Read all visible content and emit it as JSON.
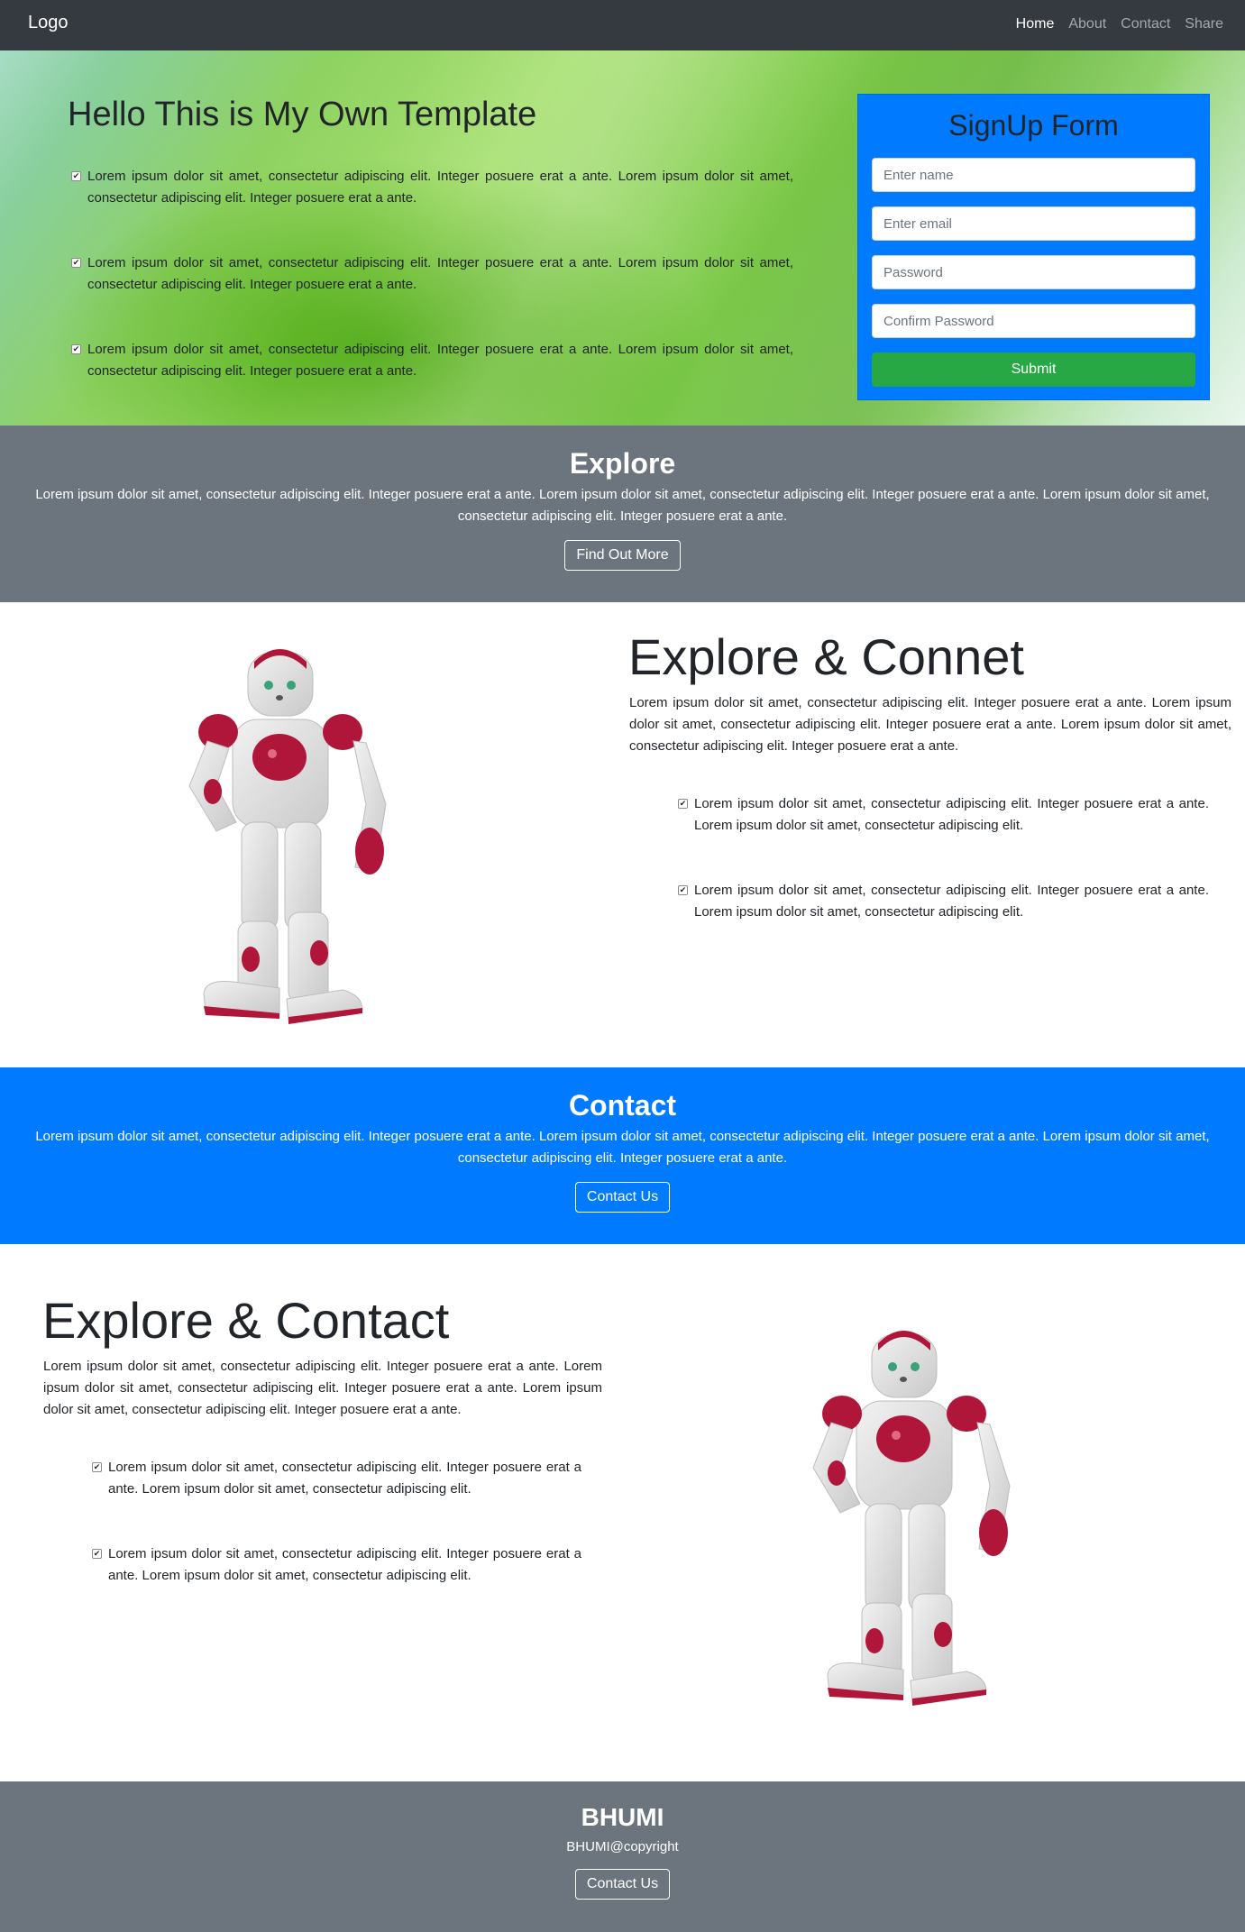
{
  "nav": {
    "brand": "Logo",
    "links": [
      "Home",
      "About",
      "Contact",
      "Share"
    ]
  },
  "hero": {
    "title": "Hello This is My Own Template",
    "items": [
      "Lorem ipsum dolor sit amet, consectetur adipiscing elit. Integer posuere erat a ante. Lorem ipsum dolor sit amet, consectetur adipiscing elit. Integer posuere erat a ante.",
      "Lorem ipsum dolor sit amet, consectetur adipiscing elit. Integer posuere erat a ante. Lorem ipsum dolor sit amet, consectetur adipiscing elit. Integer posuere erat a ante.",
      "Lorem ipsum dolor sit amet, consectetur adipiscing elit. Integer posuere erat a ante. Lorem ipsum dolor sit amet, consectetur adipiscing elit. Integer posuere erat a ante."
    ]
  },
  "signup": {
    "title": "SignUp Form",
    "name_placeholder": "Enter name",
    "email_placeholder": "Enter email",
    "password_placeholder": "Password",
    "confirm_placeholder": "Confirm Password",
    "submit_label": "Submit"
  },
  "explore_band": {
    "title": "Explore",
    "text": "Lorem ipsum dolor sit amet, consectetur adipiscing elit. Integer posuere erat a ante. Lorem ipsum dolor sit amet, consectetur adipiscing elit. Integer posuere erat a ante. Lorem ipsum dolor sit amet, consectetur adipiscing elit. Integer posuere erat a ante.",
    "button": "Find Out More"
  },
  "explore_connect": {
    "title": "Explore & Connet",
    "text": "Lorem ipsum dolor sit amet, consectetur adipiscing elit. Integer posuere erat a ante. Lorem ipsum dolor sit amet, consectetur adipiscing elit. Integer posuere erat a ante. Lorem ipsum dolor sit amet, consectetur adipiscing elit. Integer posuere erat a ante.",
    "items": [
      "Lorem ipsum dolor sit amet, consectetur adipiscing elit. Integer posuere erat a ante. Lorem ipsum dolor sit amet, consectetur adipiscing elit.",
      "Lorem ipsum dolor sit amet, consectetur adipiscing elit. Integer posuere erat a ante. Lorem ipsum dolor sit amet, consectetur adipiscing elit."
    ]
  },
  "contact_band": {
    "title": "Contact",
    "text": "Lorem ipsum dolor sit amet, consectetur adipiscing elit. Integer posuere erat a ante. Lorem ipsum dolor sit amet, consectetur adipiscing elit. Integer posuere erat a ante. Lorem ipsum dolor sit amet, consectetur adipiscing elit. Integer posuere erat a ante.",
    "button": "Contact Us"
  },
  "explore_contact": {
    "title": "Explore & Contact",
    "text": "Lorem ipsum dolor sit amet, consectetur adipiscing elit. Integer posuere erat a ante. Lorem ipsum dolor sit amet, consectetur adipiscing elit. Integer posuere erat a ante. Lorem ipsum dolor sit amet, consectetur adipiscing elit. Integer posuere erat a ante.",
    "items": [
      "Lorem ipsum dolor sit amet, consectetur adipiscing elit. Integer posuere erat a ante. Lorem ipsum dolor sit amet, consectetur adipiscing elit.",
      "Lorem ipsum dolor sit amet, consectetur adipiscing elit. Integer posuere erat a ante. Lorem ipsum dolor sit amet, consectetur adipiscing elit."
    ]
  },
  "footer": {
    "title": "BHUMI",
    "copyright": "BHUMI@copyright",
    "button": "Contact Us"
  },
  "colors": {
    "navbar": "#343a40",
    "primary": "#007bff",
    "secondary": "#6c757d",
    "success": "#28a745"
  }
}
